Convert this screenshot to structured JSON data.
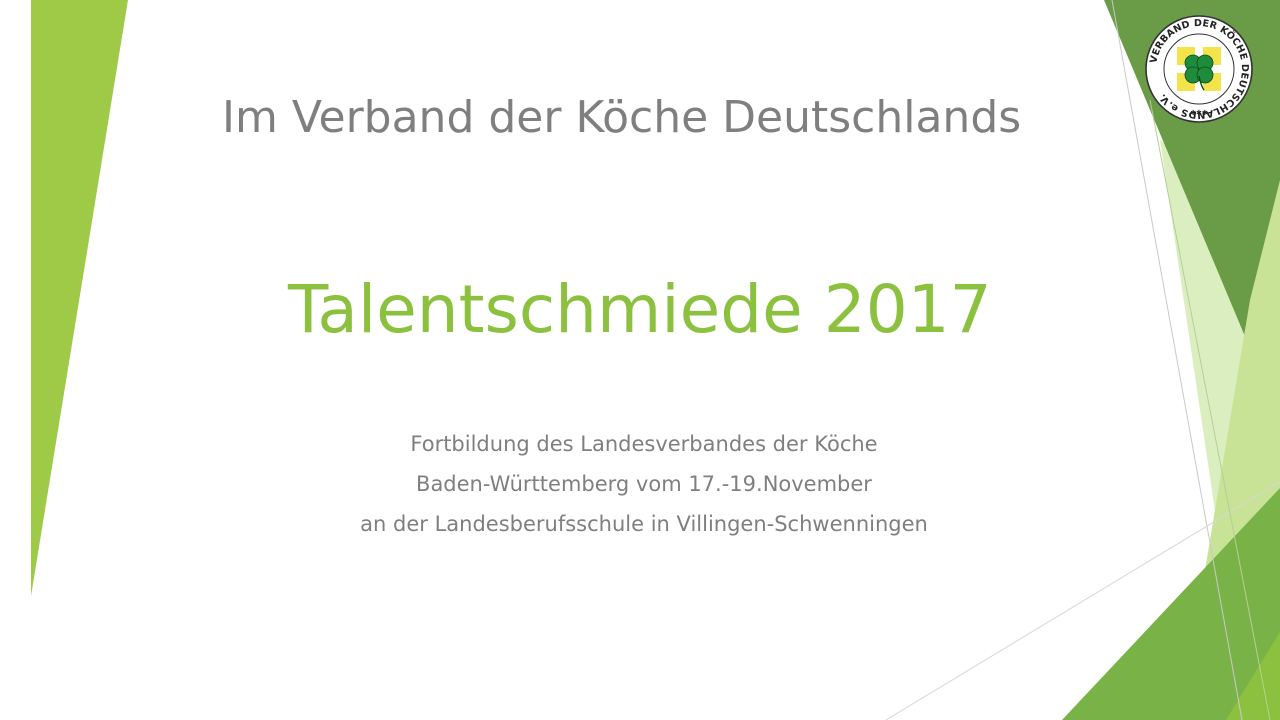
{
  "slide": {
    "pre_title": "Im Verband der Köche Deutschlands",
    "title": "Talentschmiede 2017",
    "subtitle_lines": [
      "Fortbildung des Landesverbandes der Köche",
      "Baden-Württemberg vom 17.-19.November",
      "an der Landesberufsschule in Villingen-Schwenningen"
    ]
  },
  "logo": {
    "ring_text": "VERBAND DER KÖCHE DEUTSCHLANDS e.V.",
    "stars": "✱✱✱",
    "icon": "four-leaf-clover-icon"
  },
  "colors": {
    "title_green": "#8cc13f",
    "gray_text": "#7f7f7f",
    "dark_green": "#5b8e3b",
    "mid_green": "#7ab648",
    "light_green": "#c6e19a",
    "logo_yellow": "#f4e34a",
    "logo_clover": "#1e8c3a"
  }
}
